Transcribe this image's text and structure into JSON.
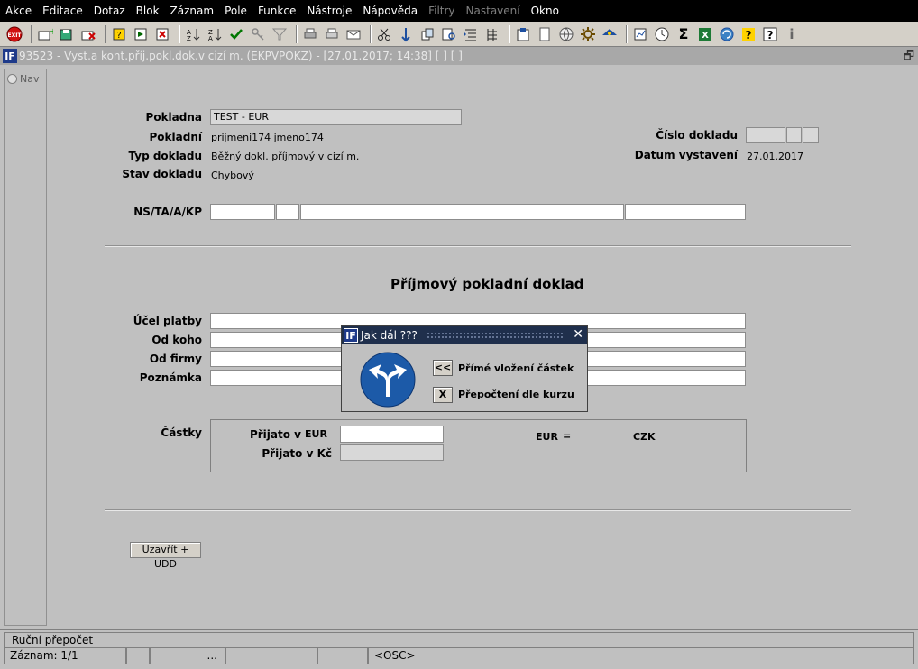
{
  "menu": [
    "Akce",
    "Editace",
    "Dotaz",
    "Blok",
    "Záznam",
    "Pole",
    "Funkce",
    "Nástroje",
    "Nápověda",
    "Filtry",
    "Nastavení",
    "Okno"
  ],
  "menu_disabled": [
    "Filtry",
    "Nastavení"
  ],
  "toolbar_icons": [
    "exit-icon",
    "insert-record-icon",
    "save-icon",
    "delete-record-icon",
    "query-icon",
    "execute-query-icon",
    "cancel-query-icon",
    "sort-asc-icon",
    "sort-desc-icon",
    "checkmark-icon",
    "key-icon",
    "filter-icon",
    "print-icon",
    "print-setup-icon",
    "mail-icon",
    "cut-icon",
    "paste-icon",
    "copy-icon",
    "find-icon",
    "list-icon",
    "tree-icon",
    "clipboard-icon",
    "page-icon",
    "globe-icon",
    "gear-icon",
    "eye-icon",
    "report-icon",
    "clock-icon",
    "sum-icon",
    "excel-icon",
    "refresh-icon",
    "help-icon",
    "question-icon",
    "info-icon"
  ],
  "window": {
    "title": "93523 - Vyst.a kont.příj.pokl.dok.v cizí m. (EKPVPOKZ) - [27.01.2017; 14:38]  [ ]  [ ]",
    "nav_label": "Nav"
  },
  "form": {
    "pokladna_label": "Pokladna",
    "pokladna_value": "TEST - EUR",
    "pokladni_label": "Pokladní",
    "pokladni_value": "prijmeni174 jmeno174",
    "typ_label": "Typ dokladu",
    "typ_value": "Běžný dokl. příjmový v cizí m.",
    "stav_label": "Stav dokladu",
    "stav_value": "Chybový",
    "cislo_label": "Číslo dokladu",
    "datum_label": "Datum vystavení",
    "datum_value": "27.01.2017",
    "ns_label": "NS/TA/A/KP",
    "heading": "Příjmový pokladní doklad",
    "ucel_label": "Účel platby",
    "odkoho_label": "Od koho",
    "odfirmy_label": "Od firmy",
    "poznamka_label": "Poznámka",
    "castky_label": "Částky",
    "prijato_v_label": "Přijato v",
    "prijato_currency": "EUR",
    "prijato_kc_label": "Přijato v Kč",
    "rate_from": "EUR",
    "rate_eq": "=",
    "rate_to": "CZK",
    "close_button": "Uzavřít + UDD"
  },
  "dialog": {
    "title": "Jak dál ???",
    "option1_key": "<<",
    "option1_label": "Přímé vložení částek",
    "option2_key": "X",
    "option2_label": "Přepočtení dle kurzu"
  },
  "status": {
    "message": "Ruční přepočet",
    "record": "Záznam: 1/1",
    "cell3": "...",
    "cell5": "<OSC>"
  }
}
